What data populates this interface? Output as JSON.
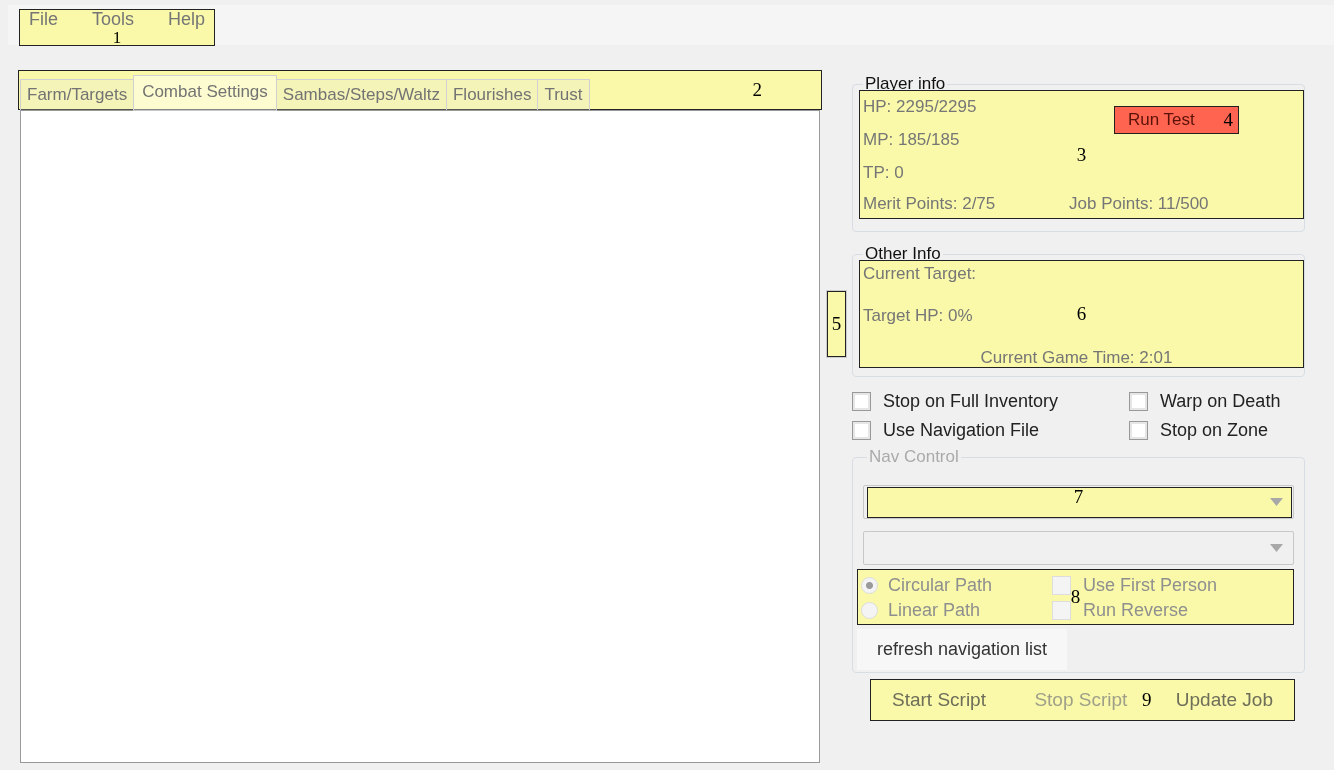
{
  "menu": {
    "annotation": "1",
    "items": [
      {
        "label": "File"
      },
      {
        "label": "Tools"
      },
      {
        "label": "Help"
      }
    ]
  },
  "tabs": {
    "annotation": "2",
    "items": [
      {
        "label": "Farm/Targets",
        "selected": false
      },
      {
        "label": "Combat Settings",
        "selected": true
      },
      {
        "label": "Sambas/Steps/Waltz",
        "selected": false
      },
      {
        "label": "Flourishes",
        "selected": false
      },
      {
        "label": "Trust",
        "selected": false
      }
    ]
  },
  "player_info": {
    "title": "Player info",
    "annotation": "3",
    "hp": "HP: 2295/2295",
    "mp": "MP: 185/185",
    "tp": "TP: 0",
    "merit_points": "Merit Points: 2/75",
    "job_points": "Job Points: 11/500",
    "run_test_button": {
      "label": "Run Test",
      "annotation": "4"
    }
  },
  "side_marker": {
    "annotation": "5"
  },
  "other_info": {
    "title": "Other Info",
    "annotation": "6",
    "current_target": "Current Target:",
    "target_hp": "Target HP: 0%",
    "game_time": "Current Game Time: 2:01"
  },
  "options": [
    {
      "label": "Stop on Full Inventory",
      "checked": false
    },
    {
      "label": "Warp on Death",
      "checked": false
    },
    {
      "label": "Use Navigation File",
      "checked": false
    },
    {
      "label": "Stop on Zone",
      "checked": false
    }
  ],
  "nav_control": {
    "title": "Nav Control",
    "disabled": true,
    "dropdown_annotation": "7",
    "path_annotation": "8",
    "paths": [
      {
        "label": "Circular Path",
        "selected": true
      },
      {
        "label": "Linear Path",
        "selected": false
      }
    ],
    "path_options": [
      {
        "label": "Use First Person",
        "checked": false
      },
      {
        "label": "Run Reverse",
        "checked": false
      }
    ],
    "refresh_button": "refresh navigation list"
  },
  "buttons": {
    "annotation": "9",
    "items": [
      {
        "label": "Start Script",
        "disabled": false
      },
      {
        "label": "Stop Script",
        "disabled": true
      },
      {
        "label": "Update Job",
        "disabled": false
      }
    ]
  }
}
